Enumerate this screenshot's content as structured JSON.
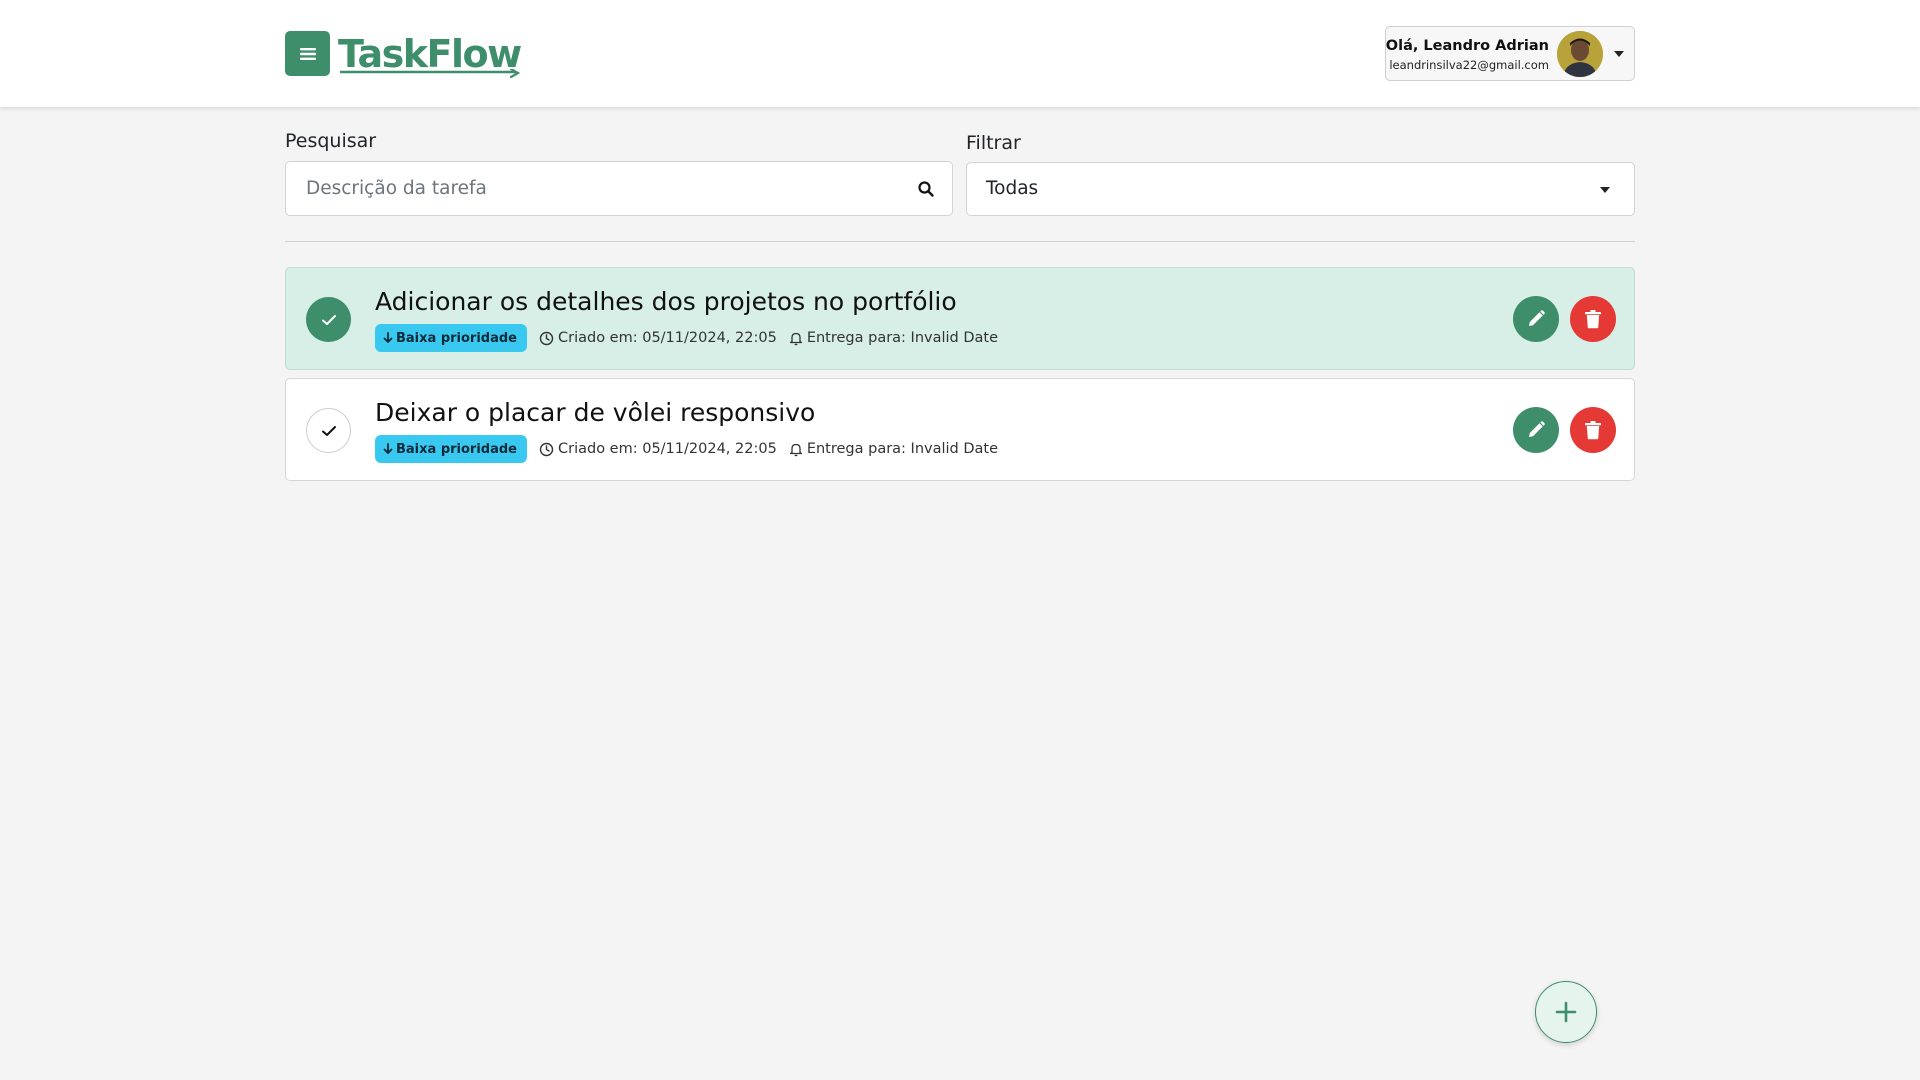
{
  "header": {
    "logo_text": "TaskFlow",
    "user": {
      "greeting": "Olá, Leandro Adrian",
      "email": "leandrinsilva22@gmail.com"
    }
  },
  "filters": {
    "search_label": "Pesquisar",
    "search_placeholder": "Descrição da tarefa",
    "search_value": "",
    "filter_label": "Filtrar",
    "filter_value": "Todas"
  },
  "tasks": [
    {
      "title": "Adicionar os detalhes dos projetos no portfólio",
      "priority": "Baixa prioridade",
      "created": "Criado em: 05/11/2024, 22:05",
      "due": "Entrega para: Invalid Date",
      "completed": true
    },
    {
      "title": "Deixar o placar de vôlei responsivo",
      "priority": "Baixa prioridade",
      "created": "Criado em: 05/11/2024, 22:05",
      "due": "Entrega para: Invalid Date",
      "completed": false
    }
  ],
  "colors": {
    "brand": "#3e8e6b",
    "danger": "#e53935",
    "badge": "#39c8f0",
    "completed_bg": "#d7efe6"
  },
  "icons": {
    "menu": "menu-icon",
    "search": "search-icon",
    "check": "check-icon",
    "edit": "pencil-icon",
    "delete": "trash-icon",
    "add": "plus-icon",
    "clock": "clock-icon",
    "bell": "bell-icon",
    "priority": "arrow-down-icon"
  }
}
